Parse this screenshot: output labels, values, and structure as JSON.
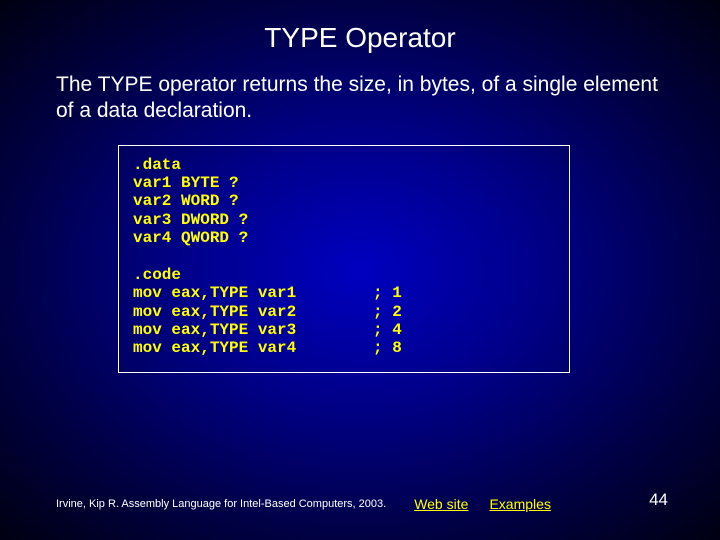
{
  "title": "TYPE Operator",
  "description": "The TYPE operator returns the size, in bytes, of a single element of a data declaration.",
  "code": ".data\nvar1 BYTE ?\nvar2 WORD ?\nvar3 DWORD ?\nvar4 QWORD ?\n\n.code\nmov eax,TYPE var1        ; 1\nmov eax,TYPE var2        ; 2\nmov eax,TYPE var3        ; 4\nmov eax,TYPE var4        ; 8",
  "footer": {
    "credit": "Irvine, Kip R. Assembly Language for Intel-Based Computers, 2003.",
    "links": {
      "website": "Web site",
      "examples": "Examples"
    }
  },
  "page_number": "44"
}
